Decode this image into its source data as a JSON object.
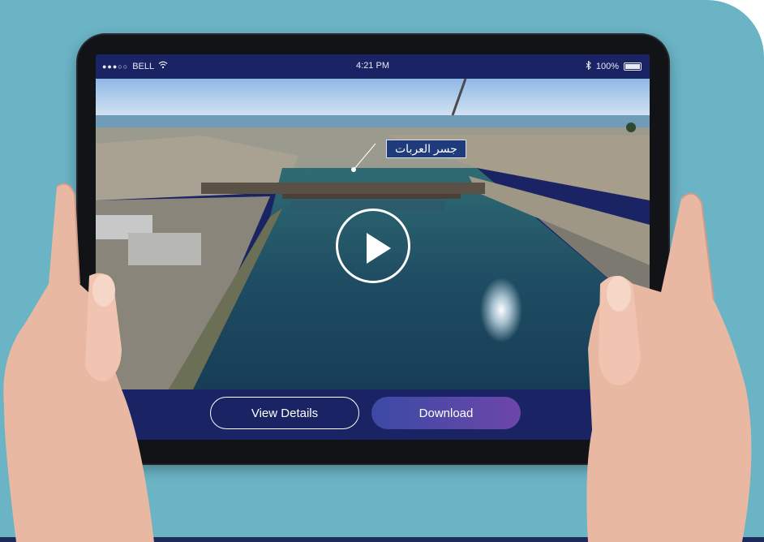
{
  "status_bar": {
    "carrier": "BELL",
    "time": "4:21 PM",
    "battery": "100%"
  },
  "video": {
    "overlay_label": "جسر العربات"
  },
  "actions": {
    "view_details_label": "View Details",
    "download_label": "Download"
  },
  "colors": {
    "background": "#6bb4c6",
    "screen_bar": "#1a2363",
    "download_gradient_start": "#3b4aa6",
    "download_gradient_end": "#6d46a8"
  },
  "icons": [
    "signal-dots-icon",
    "wifi-icon",
    "bluetooth-icon",
    "battery-icon",
    "play-icon"
  ]
}
